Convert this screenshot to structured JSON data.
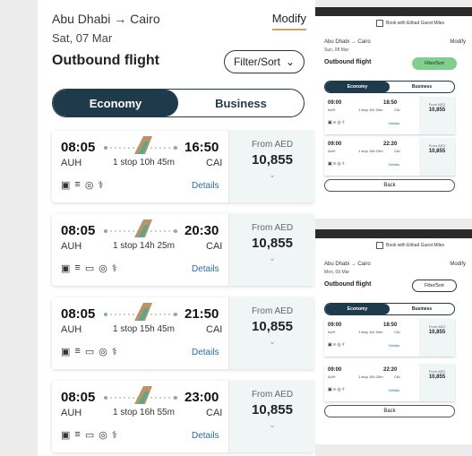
{
  "left": {
    "route": "Abu Dhabi → Cairo",
    "date": "Sat, 07 Mar",
    "modify": "Modify",
    "title": "Outbound flight",
    "filter": "Filter/Sort",
    "cabin": [
      "Economy",
      "Business"
    ],
    "flights": [
      {
        "dep": "08:05",
        "arr": "16:50",
        "from": "AUH",
        "to": "CAI",
        "stops": "1 stop 10h 45m",
        "details": "Details",
        "price_label": "From AED",
        "price": "10,855",
        "amenities": [
          "▣",
          "≡",
          "◎",
          "⚕"
        ]
      },
      {
        "dep": "08:05",
        "arr": "20:30",
        "from": "AUH",
        "to": "CAI",
        "stops": "1 stop 14h 25m",
        "details": "Details",
        "price_label": "From AED",
        "price": "10,855",
        "amenities": [
          "▣",
          "≡",
          "▭",
          "◎",
          "⚕"
        ]
      },
      {
        "dep": "08:05",
        "arr": "21:50",
        "from": "AUH",
        "to": "CAI",
        "stops": "1 stop 15h 45m",
        "details": "Details",
        "price_label": "From AED",
        "price": "10,855",
        "amenities": [
          "▣",
          "≡",
          "▭",
          "◎",
          "⚕"
        ]
      },
      {
        "dep": "08:05",
        "arr": "23:00",
        "from": "AUH",
        "to": "CAI",
        "stops": "1 stop 16h 55m",
        "details": "Details",
        "price_label": "From AED",
        "price": "10,855",
        "amenities": [
          "▣",
          "≡",
          "▭",
          "◎",
          "⚕"
        ]
      }
    ]
  },
  "mini_top": {
    "check": "Book with Etihad Guest Miles",
    "route": "Abu Dhabi → Cairo",
    "date": "Sun, 08 Mar",
    "modify": "Modify",
    "title": "Outbound flight",
    "filter": "Filter/Sort",
    "cabin": [
      "Economy",
      "Business"
    ],
    "flights": [
      {
        "dep": "09:00",
        "arr": "18:50",
        "from": "AUH",
        "stops": "1 stop 11h 50m",
        "to": "CAI",
        "price_label": "From AED",
        "price": "10,855",
        "details": "Details"
      },
      {
        "dep": "09:00",
        "arr": "22:20",
        "from": "AUH",
        "stops": "1 stop 15h 20m",
        "to": "CAI",
        "price_label": "From AED",
        "price": "10,855",
        "details": "Details"
      }
    ],
    "back": "Back"
  },
  "mini_bottom": {
    "check": "Book with Etihad Guest Miles",
    "route": "Abu Dhabi → Cairo",
    "date": "Mon, 09 Mar",
    "modify": "Modify",
    "title": "Outbound flight",
    "filter": "Filter/Sort",
    "cabin": [
      "Economy",
      "Business"
    ],
    "flights": [
      {
        "dep": "09:00",
        "arr": "18:50",
        "from": "AUH",
        "stops": "1 stop 11h 50m",
        "to": "CAI",
        "price_label": "From AED",
        "price": "10,855",
        "details": "Details"
      },
      {
        "dep": "09:00",
        "arr": "22:20",
        "from": "AUH",
        "stops": "1 stop 15h 20m",
        "to": "CAI",
        "price_label": "From AED",
        "price": "10,855",
        "details": "Details"
      }
    ],
    "back": "Back"
  },
  "colors": {
    "accent": "#1f3a4b",
    "price_bg": "#eff6f5",
    "link": "#2a6bb0",
    "gold": "#c9a36a"
  }
}
